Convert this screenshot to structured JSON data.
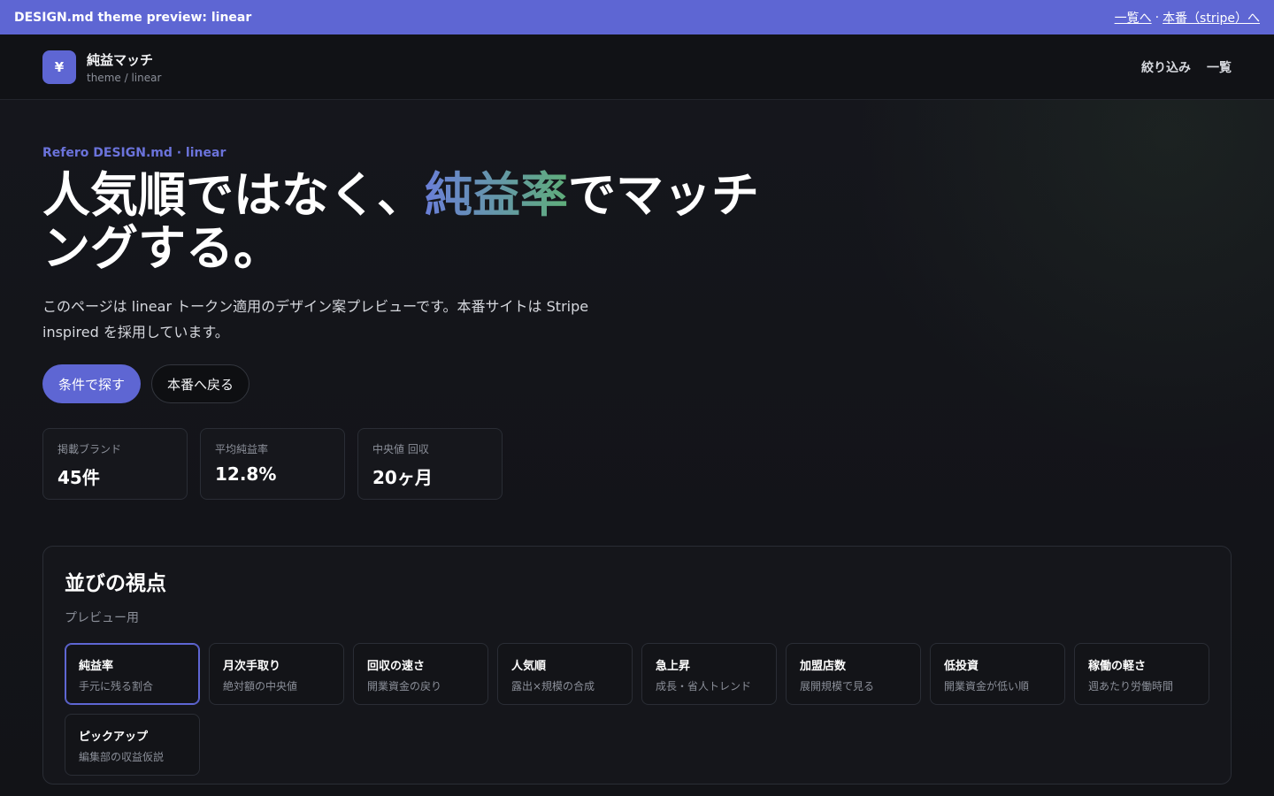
{
  "preview_bar": {
    "title": "DESIGN.md theme preview: linear",
    "link_list": "一覧へ",
    "separator": "·",
    "link_prod": "本番（stripe）へ"
  },
  "header": {
    "logo_glyph": "¥",
    "brand_name": "純益マッチ",
    "brand_sub": "theme / linear",
    "nav": [
      "絞り込み",
      "一覧"
    ]
  },
  "hero": {
    "eyebrow": "Refero DESIGN.md · linear",
    "headline_pre": "人気順ではなく、",
    "headline_accent": "純益率",
    "headline_post": "でマッチングする。",
    "lead": "このページは linear トークン適用のデザイン案プレビューです。本番サイトは Stripe inspired を採用しています。",
    "primary_button": "条件で探す",
    "secondary_button": "本番へ戻る"
  },
  "stats": [
    {
      "label": "掲載ブランド",
      "value": "45件"
    },
    {
      "label": "平均純益率",
      "value": "12.8%"
    },
    {
      "label": "中央値 回収",
      "value": "20ヶ月"
    }
  ],
  "sort_panel": {
    "title": "並びの視点",
    "subtitle": "プレビュー用",
    "options": [
      {
        "title": "純益率",
        "desc": "手元に残る割合",
        "selected": true
      },
      {
        "title": "月次手取り",
        "desc": "絶対額の中央値",
        "selected": false
      },
      {
        "title": "回収の速さ",
        "desc": "開業資金の戻り",
        "selected": false
      },
      {
        "title": "人気順",
        "desc": "露出×規模の合成",
        "selected": false
      },
      {
        "title": "急上昇",
        "desc": "成長・省人トレンド",
        "selected": false
      },
      {
        "title": "加盟店数",
        "desc": "展開規模で見る",
        "selected": false
      },
      {
        "title": "低投資",
        "desc": "開業資金が低い順",
        "selected": false
      },
      {
        "title": "稼働の軽さ",
        "desc": "週あたり労働時間",
        "selected": false
      },
      {
        "title": "ピックアップ",
        "desc": "編集部の収益仮説",
        "selected": false
      }
    ]
  },
  "colors": {
    "accent": "#5e66d3",
    "background": "#121317",
    "gradient_start": "#6a7fd8",
    "gradient_end": "#5fae7a"
  }
}
